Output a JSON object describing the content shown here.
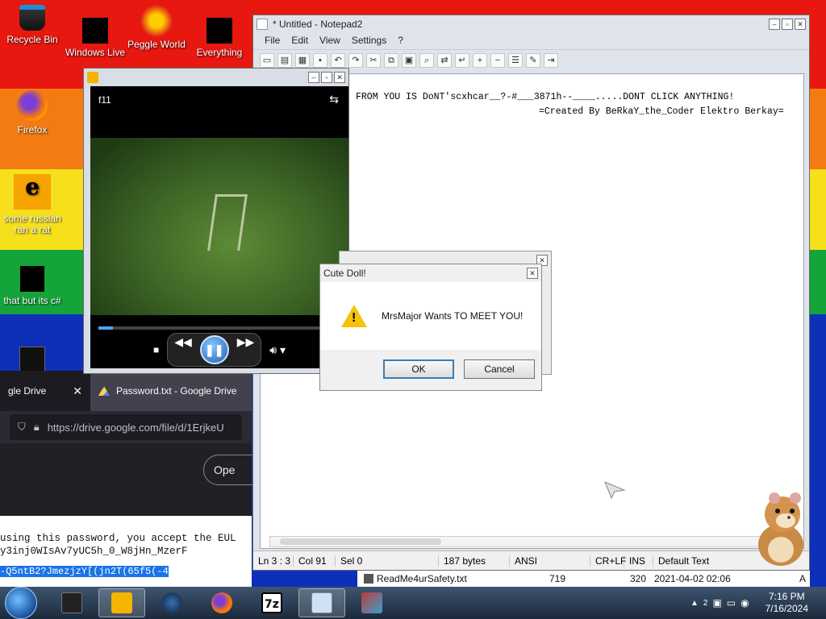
{
  "desktop": {
    "icons": [
      {
        "label": "Recycle Bin"
      },
      {
        "label": "Windows Live"
      },
      {
        "label": "Peggle World"
      },
      {
        "label": "Everything"
      },
      {
        "label": "Firefox"
      },
      {
        "label": "some russian ran a rat"
      },
      {
        "label": "that but its c#"
      }
    ]
  },
  "notepad": {
    "title": "* Untitled - Notepad2",
    "menu": [
      "File",
      "Edit",
      "View",
      "Settings",
      "?"
    ],
    "lines": [
      "FROM YOU IS DoNT'scxhcar__?-#___3871h--____.....DONT CLICK ANYTHING!",
      "=Created By BeRkaY_the_Coder Elektro Berkay="
    ],
    "status": {
      "position": "Ln 3 : 3",
      "col": "Col 91",
      "sel": "Sel 0",
      "size": "187 bytes",
      "encoding": "ANSI",
      "eol": "CR+LF",
      "mode": "INS",
      "scheme": "Default Text"
    }
  },
  "player": {
    "label": "f11",
    "progress": 0.06
  },
  "dialog": {
    "title": "Cute Doll!",
    "message": "MrsMajor Wants TO MEET YOU!",
    "ok": "OK",
    "cancel": "Cancel"
  },
  "firefox": {
    "tab1": "gle Drive",
    "tab2": "Password.txt - Google Drive",
    "url": "https://drive.google.com/file/d/1ErjkeU",
    "open": "Ope",
    "line1": "using this password, you accept the EUL",
    "line2": "y3inj0WIsAv7yUC5h_0_W8jHn_MzerF",
    "selected": "-Q5ntB2?JmezjzY[(jn2T(65f5(-4"
  },
  "filerow": {
    "name": "ReadMe4urSafety.txt",
    "num1": "719",
    "num2": "320",
    "date": "2021-04-02 02:06",
    "attr": "A"
  },
  "taskbar": {
    "time": "7:16 PM",
    "date": "7/16/2024",
    "tray_badge": "2"
  }
}
